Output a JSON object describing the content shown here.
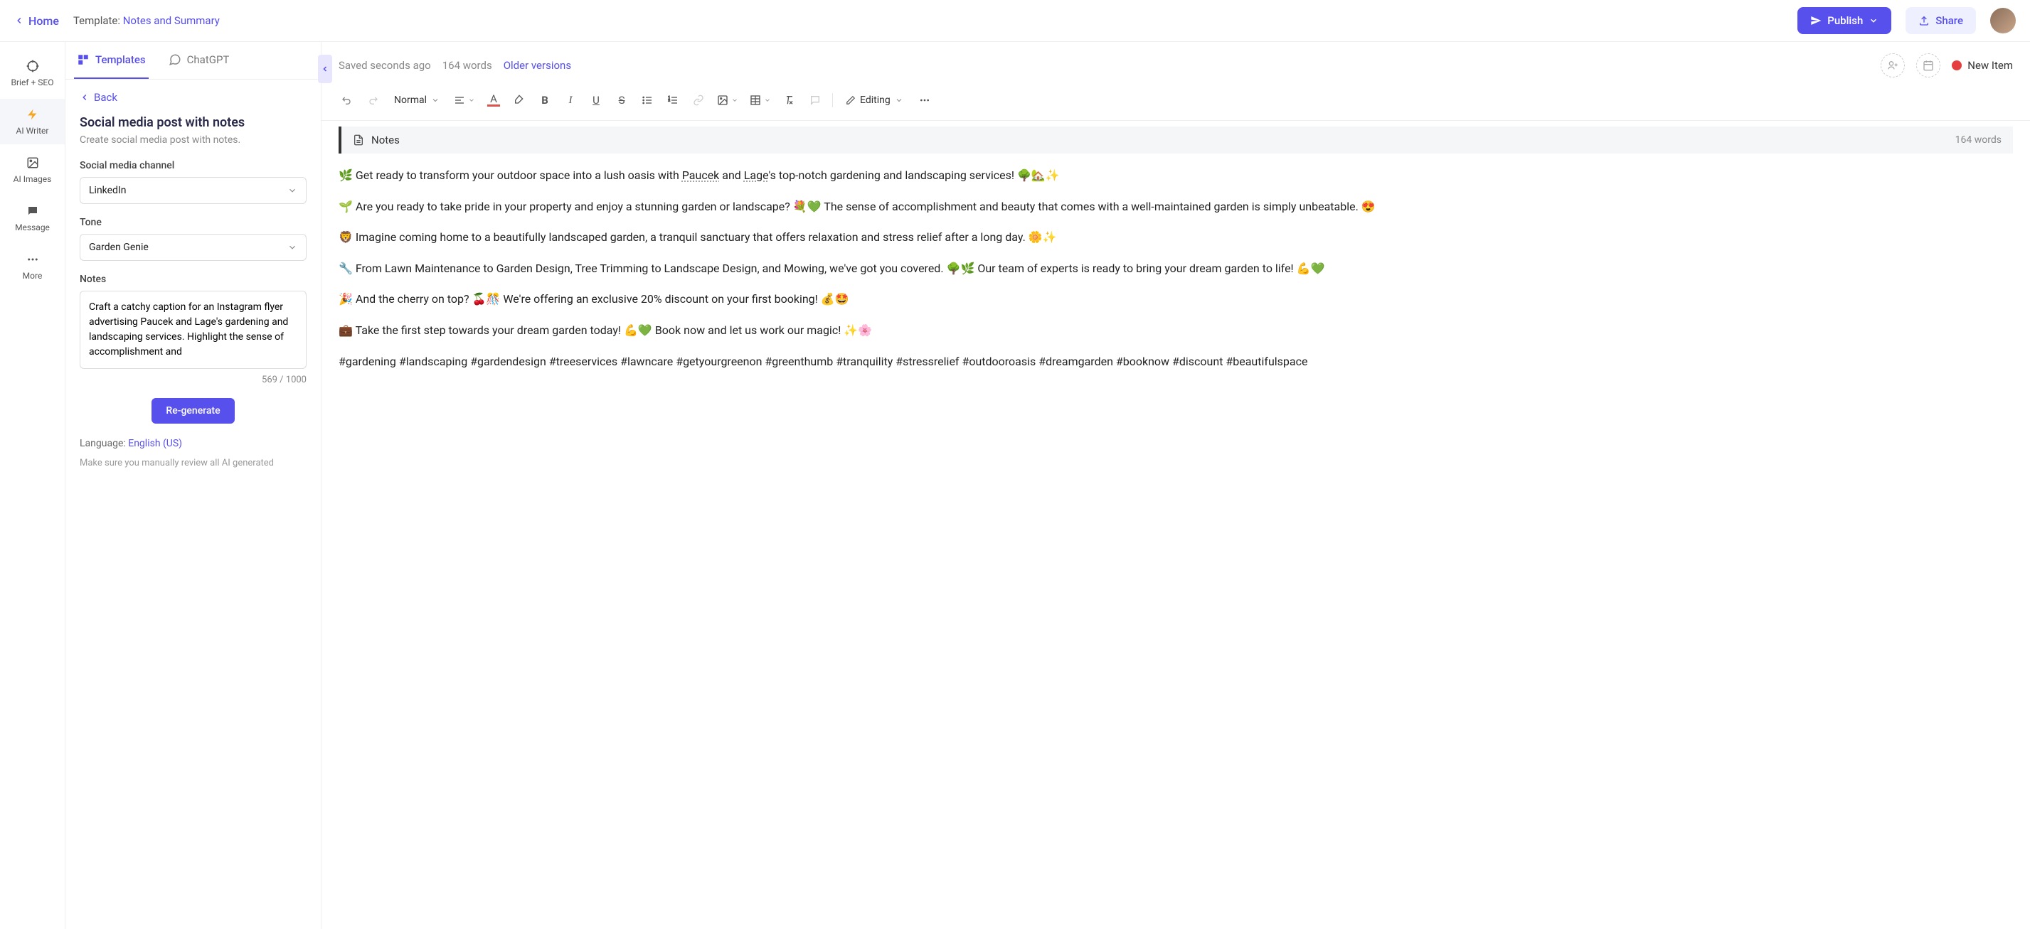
{
  "top": {
    "home": "Home",
    "template_prefix": "Template: ",
    "template_name": "Notes and Summary",
    "publish": "Publish",
    "share": "Share"
  },
  "nav": {
    "brief": "Brief + SEO",
    "writer": "AI Writer",
    "images": "AI Images",
    "message": "Message",
    "more": "More"
  },
  "side": {
    "tab_templates": "Templates",
    "tab_chatgpt": "ChatGPT",
    "back": "Back",
    "title": "Social media post with notes",
    "desc": "Create social media post with notes.",
    "channel_label": "Social media channel",
    "channel_value": "LinkedIn",
    "tone_label": "Tone",
    "tone_value": "Garden Genie",
    "notes_label": "Notes",
    "notes_value": "Craft a catchy caption for an Instagram flyer advertising Paucek and Lage's gardening and landscaping services. Highlight the sense of accomplishment and",
    "char_count": "569 / 1000",
    "regenerate": "Re-generate",
    "language_prefix": "Language: ",
    "language_value": "English (US)",
    "review_note": "Make sure you manually review all AI generated"
  },
  "editor": {
    "saved": "Saved seconds ago",
    "words_top": "164 words",
    "older": "Older versions",
    "new_item": "New Item",
    "style_normal": "Normal",
    "editing": "Editing",
    "notes_title": "Notes",
    "notes_count": "164 words"
  },
  "content": {
    "p1_a": "🌿 Get ready to transform your outdoor space into a lush oasis with ",
    "p1_m1": "Paucek",
    "p1_b": " and ",
    "p1_m2": "Lage",
    "p1_c": "'s top-notch gardening and landscaping services! 🌳🏡✨",
    "p2": "🌱 Are you ready to take pride in your property and enjoy a stunning garden or landscape? 💐💚 The sense of accomplishment and beauty that comes with a well-maintained garden is simply unbeatable. 😍",
    "p3": "🦁 Imagine coming home to a beautifully landscaped garden, a tranquil sanctuary that offers relaxation and stress relief after a long day. 🌼✨",
    "p4": "🔧 From Lawn Maintenance to Garden Design, Tree Trimming to Landscape Design, and Mowing, we've got you covered. 🌳🌿 Our team of experts is ready to bring your dream garden to life! 💪💚",
    "p5": "🎉 And the cherry on top? 🍒🎊 We're offering an exclusive 20% discount on your first booking! 💰🤩",
    "p6": "💼 Take the first step towards your dream garden today! 💪💚 Book now and let us work our magic! ✨🌸",
    "p7": "#gardening #landscaping #gardendesign #treeservices #lawncare #getyourgreenon #greenthumb #tranquility #stressrelief #outdooroasis #dreamgarden #booknow #discount #beautifulspace"
  }
}
